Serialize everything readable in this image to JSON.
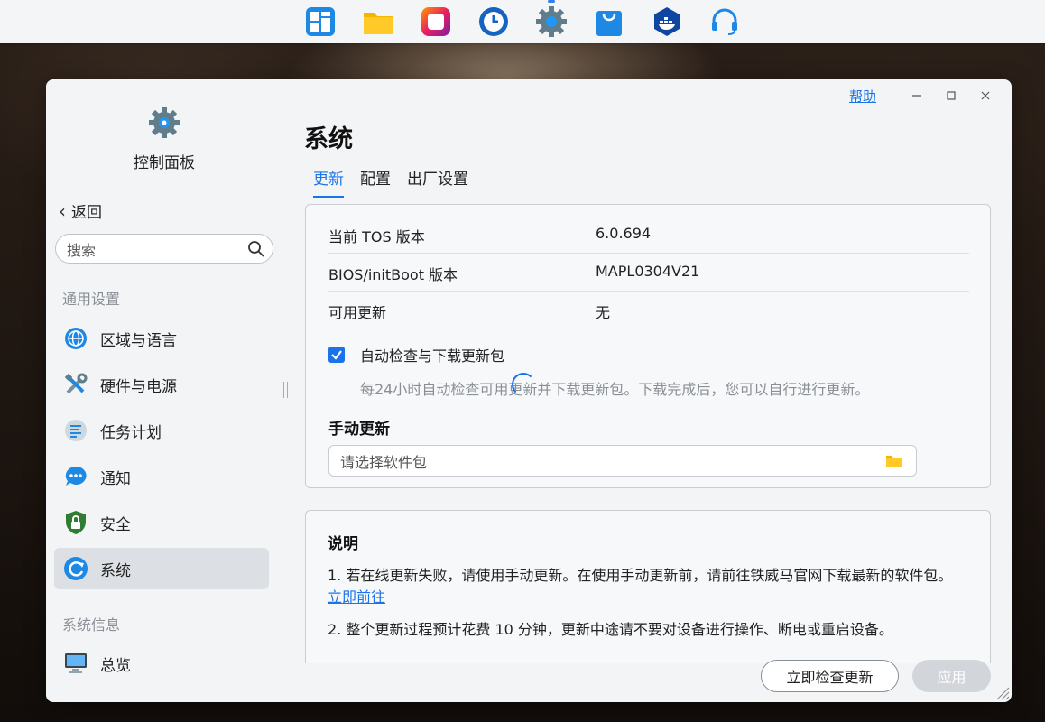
{
  "taskbar": {
    "icons": [
      "app-store-icon",
      "file-manager-icon",
      "picture-icon",
      "backup-icon",
      "control-panel-icon",
      "shop-icon",
      "docker-icon",
      "support-icon"
    ]
  },
  "window": {
    "help": "帮助"
  },
  "sidebar": {
    "title": "控制面板",
    "back": "返回",
    "search_placeholder": "搜索",
    "section_general": "通用设置",
    "items": [
      {
        "label": "区域与语言",
        "icon": "globe-icon"
      },
      {
        "label": "硬件与电源",
        "icon": "tools-icon"
      },
      {
        "label": "任务计划",
        "icon": "task-icon"
      },
      {
        "label": "通知",
        "icon": "chat-icon"
      },
      {
        "label": "安全",
        "icon": "shield-icon"
      },
      {
        "label": "系统",
        "icon": "system-update-icon"
      }
    ],
    "section_info": "系统信息",
    "info_items": [
      {
        "label": "总览",
        "icon": "monitor-icon"
      }
    ]
  },
  "main": {
    "title": "系统",
    "tabs": [
      "更新",
      "配置",
      "出厂设置"
    ],
    "info": [
      {
        "key": "当前 TOS 版本",
        "value": "6.0.694"
      },
      {
        "key": "BIOS/initBoot 版本",
        "value": "MAPL0304V21"
      },
      {
        "key": "可用更新",
        "value": "无"
      }
    ],
    "auto_check_label": "自动检查与下载更新包",
    "auto_check_desc": "每24小时自动检查可用更新并下载更新包。下载完成后，您可以自行进行更新。",
    "manual_title": "手动更新",
    "file_placeholder": "请选择软件包",
    "notes": {
      "title": "说明",
      "note1": "1. 若在线更新失败，请使用手动更新。在使用手动更新前，请前往铁威马官网下载最新的软件包。",
      "note1_link": "立即前往",
      "note2": "2. 整个更新过程预计花费 10 分钟，更新中途请不要对设备进行操作、断电或重启设备。"
    },
    "btn_check": "立即检查更新",
    "btn_apply": "应用"
  }
}
